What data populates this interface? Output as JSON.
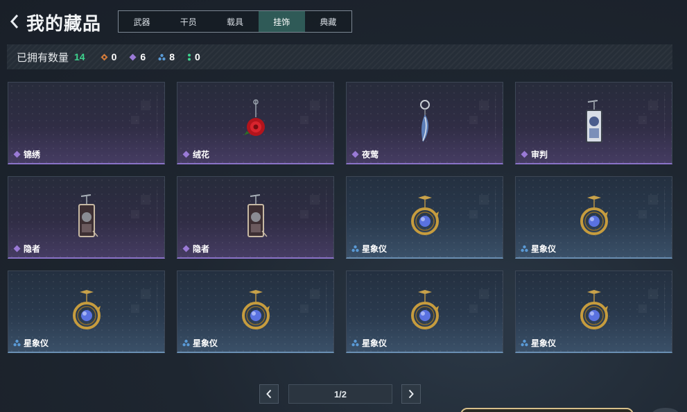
{
  "header": {
    "title": "我的藏品",
    "tabs": [
      {
        "label": "武器",
        "active": false
      },
      {
        "label": "干员",
        "active": false
      },
      {
        "label": "载具",
        "active": false
      },
      {
        "label": "挂饰",
        "active": true
      },
      {
        "label": "典藏",
        "active": false
      }
    ]
  },
  "counts": {
    "owned_label": "已拥有数量",
    "owned_value": "14",
    "rarities": [
      {
        "icon": "orange-diamond-icon",
        "color": "#d07a3a",
        "value": "0"
      },
      {
        "icon": "purple-diamond-icon",
        "color": "#9a7ad6",
        "value": "6"
      },
      {
        "icon": "blue-cluster-icon",
        "color": "#5a9ad6",
        "value": "8"
      },
      {
        "icon": "green-dots-icon",
        "color": "#3ed38e",
        "value": "0"
      }
    ]
  },
  "items": [
    {
      "name": "锦绣",
      "rarity": "purple",
      "art": "none"
    },
    {
      "name": "绒花",
      "rarity": "purple",
      "art": "rose"
    },
    {
      "name": "夜莺",
      "rarity": "purple",
      "art": "feather"
    },
    {
      "name": "审判",
      "rarity": "purple",
      "art": "card-white"
    },
    {
      "name": "隐者",
      "rarity": "purple",
      "art": "card-dark"
    },
    {
      "name": "隐者",
      "rarity": "purple",
      "art": "card-dark"
    },
    {
      "name": "星象仪",
      "rarity": "blue",
      "art": "astrolabe"
    },
    {
      "name": "星象仪",
      "rarity": "blue",
      "art": "astrolabe"
    },
    {
      "name": "星象仪",
      "rarity": "blue",
      "art": "astrolabe"
    },
    {
      "name": "星象仪",
      "rarity": "blue",
      "art": "astrolabe"
    },
    {
      "name": "星象仪",
      "rarity": "blue",
      "art": "astrolabe"
    },
    {
      "name": "星象仪",
      "rarity": "blue",
      "art": "astrolabe"
    }
  ],
  "pager": {
    "page_text": "1/2",
    "current": 1,
    "total": 2
  },
  "colors": {
    "accent_green": "#3ed38e",
    "purple_rarity": "#8a73c8",
    "blue_rarity": "#6a8fb3"
  }
}
